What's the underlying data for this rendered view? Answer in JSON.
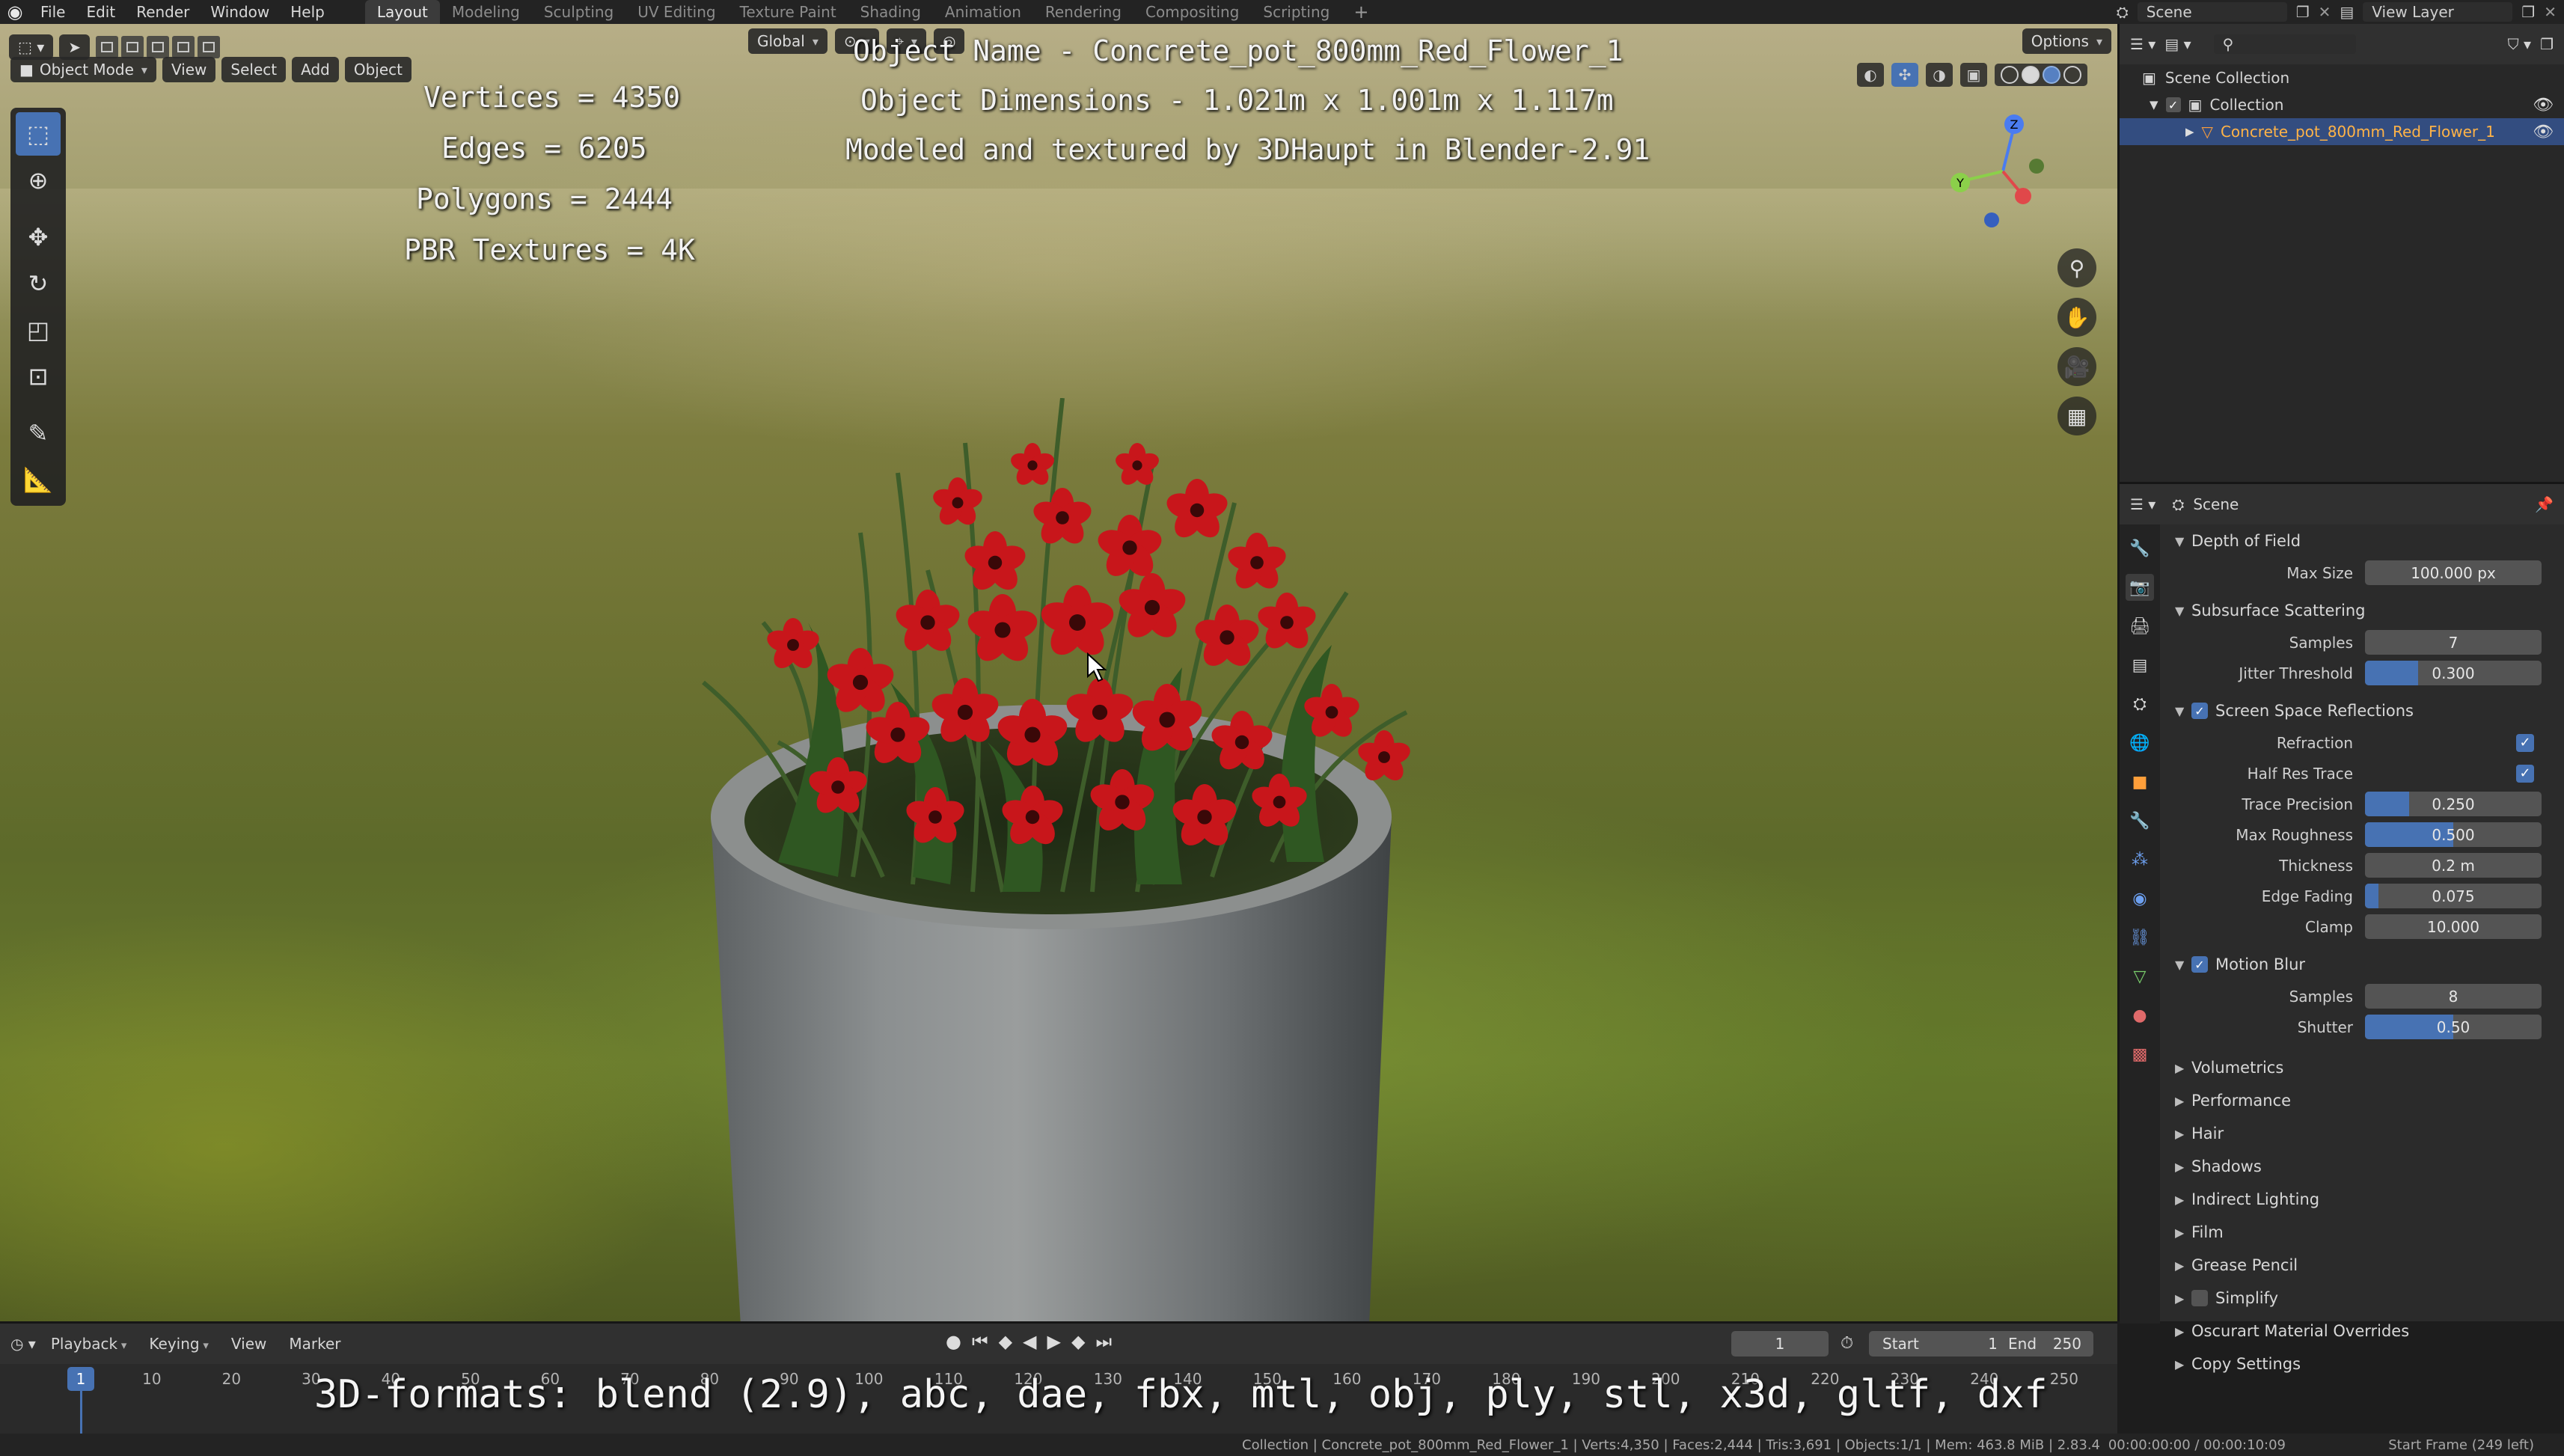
{
  "app": {
    "menu": [
      "File",
      "Edit",
      "Render",
      "Window",
      "Help"
    ],
    "workspaces": [
      "Layout",
      "Modeling",
      "Sculpting",
      "UV Editing",
      "Texture Paint",
      "Shading",
      "Animation",
      "Rendering",
      "Compositing",
      "Scripting"
    ],
    "active_workspace": "Layout",
    "scene": "Scene",
    "view_layer": "View Layer"
  },
  "viewport": {
    "mode": "Object Mode",
    "menus": [
      "View",
      "Select",
      "Add",
      "Object"
    ],
    "orientation": "Global",
    "options_label": "Options",
    "overlay_text": {
      "object_name": "Object Name - Concrete_pot_800mm_Red_Flower_1",
      "dimensions": "Object Dimensions -  1.021m x 1.001m x 1.117m",
      "credit": "Modeled and textured by 3DHaupt in Blender-2.91",
      "vertices": "Vertices = 4350",
      "edges": "Edges = 6205",
      "polygons": "Polygons = 2444",
      "textures": "PBR Textures = 4K"
    },
    "gizmo_axes": [
      "Z",
      "Y"
    ]
  },
  "outliner": {
    "root": "Scene Collection",
    "collection": "Collection",
    "object": "Concrete_pot_800mm_Red_Flower_1"
  },
  "properties": {
    "context": "Scene",
    "sections": {
      "dof": {
        "title": "Depth of Field",
        "max_size_label": "Max Size",
        "max_size": "100.000 px"
      },
      "sss": {
        "title": "Subsurface Scattering",
        "samples_label": "Samples",
        "samples": "7",
        "jitter_label": "Jitter Threshold",
        "jitter": "0.300",
        "jitter_fraction": 0.3
      },
      "ssr": {
        "title": "Screen Space Reflections",
        "enabled": true,
        "refraction_label": "Refraction",
        "refraction": true,
        "half_res_label": "Half Res Trace",
        "half_res": true,
        "trace_precision_label": "Trace Precision",
        "trace_precision": "0.250",
        "trace_precision_fraction": 0.25,
        "max_roughness_label": "Max Roughness",
        "max_roughness": "0.500",
        "max_roughness_fraction": 0.5,
        "thickness_label": "Thickness",
        "thickness": "0.2 m",
        "edge_fading_label": "Edge Fading",
        "edge_fading": "0.075",
        "edge_fading_fraction": 0.075,
        "clamp_label": "Clamp",
        "clamp": "10.000"
      },
      "motion_blur": {
        "title": "Motion Blur",
        "enabled": true,
        "samples_label": "Samples",
        "samples": "8",
        "shutter_label": "Shutter",
        "shutter": "0.50",
        "shutter_fraction": 0.5
      },
      "collapsed": [
        "Volumetrics",
        "Performance",
        "Hair",
        "Shadows",
        "Indirect Lighting",
        "Film",
        "Grease Pencil",
        "Simplify",
        "Oscurart Material Overrides",
        "Copy Settings"
      ]
    }
  },
  "timeline": {
    "menus": [
      "Playback",
      "Keying",
      "View",
      "Marker"
    ],
    "current_frame": "1",
    "start_label": "Start",
    "start": "1",
    "end_label": "End",
    "end": "250",
    "ruler_ticks": [
      "10",
      "20",
      "30",
      "40",
      "50",
      "60",
      "70",
      "80",
      "90",
      "100",
      "110",
      "120",
      "130",
      "140",
      "150",
      "160",
      "170",
      "180",
      "190",
      "200",
      "210",
      "220",
      "230",
      "240",
      "250"
    ],
    "formats_caption": "3D-formats: blend (2.9), abc, dae, fbx, mtl, obj, ply, stl, x3d, gltf, dxf"
  },
  "statusbar": {
    "stats": "Collection | Concrete_pot_800mm_Red_Flower_1 | Verts:4,350 | Faces:2,444 | Tris:3,691 | Objects:1/1 | Mem: 463.8 MiB | 2.83.4",
    "timecode": "00:00:00:00 / 00:00:10:09",
    "start_frame": "Start Frame (249 left)"
  },
  "colors": {
    "accent": "#4772b3",
    "selected_text": "#ffb347",
    "flower": "#c8161b"
  }
}
